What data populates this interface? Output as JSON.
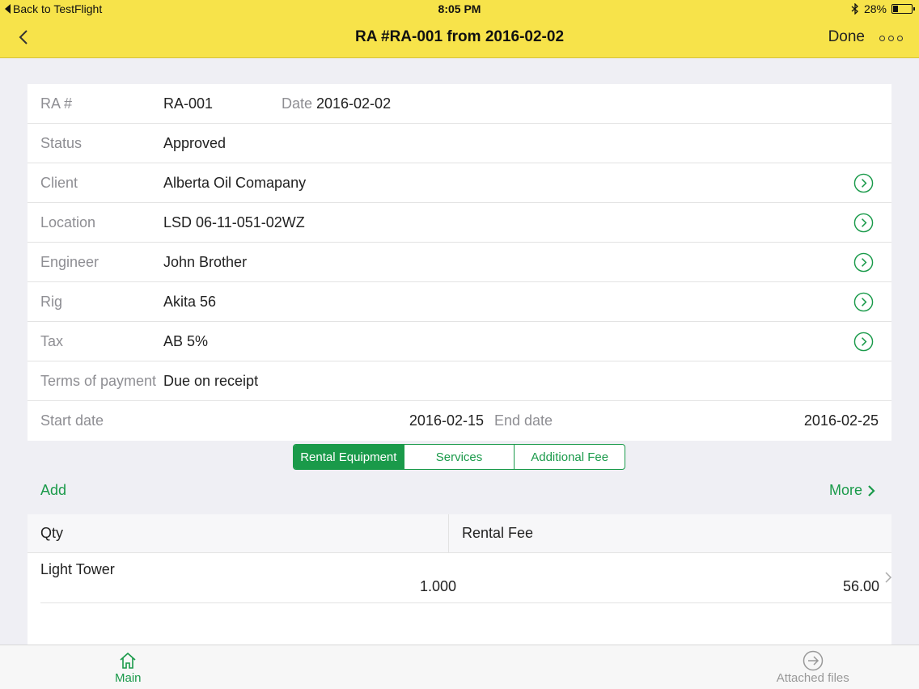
{
  "status_bar": {
    "back_text": "Back to TestFlight",
    "time": "8:05 PM",
    "battery": "28%",
    "battery_fraction": 0.28
  },
  "nav": {
    "title": "RA #RA-001 from 2016-02-02",
    "done_label": "Done"
  },
  "form": {
    "ra_label": "RA #",
    "ra_value": "RA-001",
    "date_label": "Date",
    "date_value": "2016-02-02",
    "status_label": "Status",
    "status_value": "Approved",
    "client_label": "Client",
    "client_value": "Alberta Oil Comapany",
    "location_label": "Location",
    "location_value": "LSD 06-11-051-02WZ",
    "engineer_label": "Engineer",
    "engineer_value": "John Brother",
    "rig_label": "Rig",
    "rig_value": "Akita 56",
    "tax_label": "Tax",
    "tax_value": "AB 5%",
    "terms_label": "Terms of payment",
    "terms_value": "Due on receipt",
    "start_label": "Start date",
    "start_value": "2016-02-15",
    "end_label": "End date",
    "end_value": "2016-02-25"
  },
  "segments": [
    "Rental Equipment",
    "Services",
    "Additional Fee"
  ],
  "actions": {
    "add_label": "Add",
    "more_label": "More"
  },
  "table": {
    "col_qty": "Qty",
    "col_fee": "Rental Fee",
    "rows": [
      {
        "name": "Light Tower",
        "qty": "1.000",
        "fee": "56.00"
      }
    ]
  },
  "tabs": {
    "main": "Main",
    "files": "Attached files"
  },
  "colors": {
    "nav_bg": "#f7e34a",
    "accent": "#1a9a4a"
  }
}
